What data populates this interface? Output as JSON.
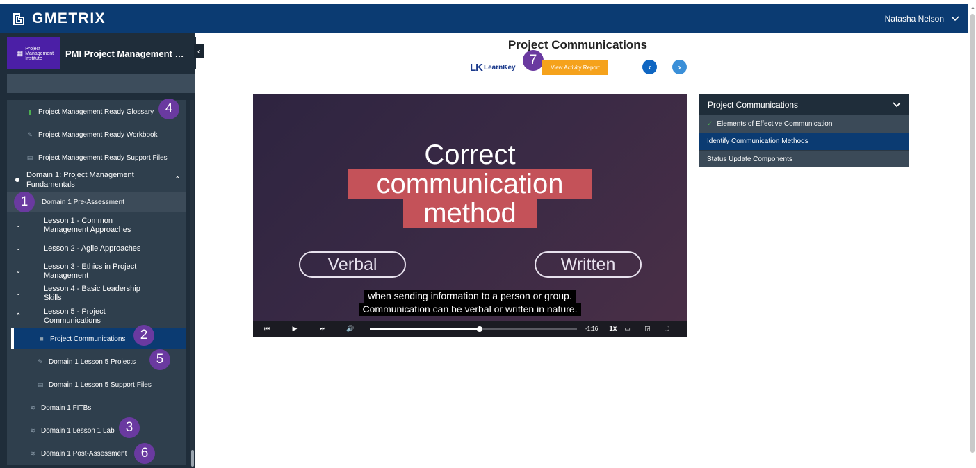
{
  "topbar": {
    "brand": "GMETRIX",
    "user_name": "Natasha Nelson"
  },
  "course": {
    "title": "PMI Project Management R...",
    "thumb_label": "Project Management Institute"
  },
  "sidebar": {
    "resources": [
      {
        "label": "Project Management Ready Glossary",
        "icon": "book-icon"
      },
      {
        "label": "Project Management Ready Workbook",
        "icon": "pencil-icon"
      },
      {
        "label": "Project Management Ready Support Files",
        "icon": "file-icon"
      }
    ],
    "domain": {
      "line1": "Domain 1: Project Management",
      "line2": "Fundamentals"
    },
    "pre_assessment": "Domain 1 Pre-Assessment",
    "lessons": [
      {
        "line1": "Lesson 1 - Common",
        "line2": "Management Approaches"
      },
      {
        "line1": "Lesson 2 - Agile Approaches",
        "line2": ""
      },
      {
        "line1": "Lesson 3 - Ethics in Project",
        "line2": "Management"
      },
      {
        "line1": "Lesson 4 - Basic Leadership",
        "line2": "Skills"
      },
      {
        "line1": "Lesson 5 - Project",
        "line2": "Communications"
      }
    ],
    "lesson5_items": [
      {
        "label": "Project Communications",
        "icon": "video-icon"
      },
      {
        "label": "Domain 1 Lesson 5 Projects",
        "icon": "pencil-icon"
      },
      {
        "label": "Domain 1 Lesson 5 Support Files",
        "icon": "file-icon"
      }
    ],
    "domain_items": [
      {
        "label": "Domain 1 FITBs",
        "icon": "assessment-icon"
      },
      {
        "label": "Domain 1 Lesson 1 Lab",
        "icon": "assessment-icon"
      },
      {
        "label": "Domain 1 Post-Assessment",
        "icon": "assessment-icon"
      }
    ]
  },
  "badges": {
    "b1": "1",
    "b2": "2",
    "b3": "3",
    "b4": "4",
    "b5": "5",
    "b6": "6",
    "b7": "7"
  },
  "main": {
    "title": "Project Communications",
    "learnkey_mark": "LK",
    "learnkey_label": "LearnKey",
    "report_button": "View Activity Report"
  },
  "video": {
    "line1": "Correct",
    "line2": "communication",
    "line3": "method",
    "pill_left": "Verbal",
    "pill_right": "Written",
    "caption1": "when sending information to a person or group.",
    "caption2": "Communication can be verbal or written in nature.",
    "time_remaining": "-1:16",
    "playback_rate": "1x",
    "progress": 0.53
  },
  "panel": {
    "header": "Project Communications",
    "items": [
      {
        "label": "Elements of Effective Communication",
        "status": "done"
      },
      {
        "label": "Identify Communication Methods",
        "status": "current"
      },
      {
        "label": "Status Update Components",
        "status": "pending"
      }
    ]
  },
  "colors": {
    "topbar": "#0b3b72",
    "sidebar": "#1f2d3a",
    "accent_orange": "#f5a21c",
    "badge": "#6a3aa0",
    "video_highlight": "#c45259"
  }
}
